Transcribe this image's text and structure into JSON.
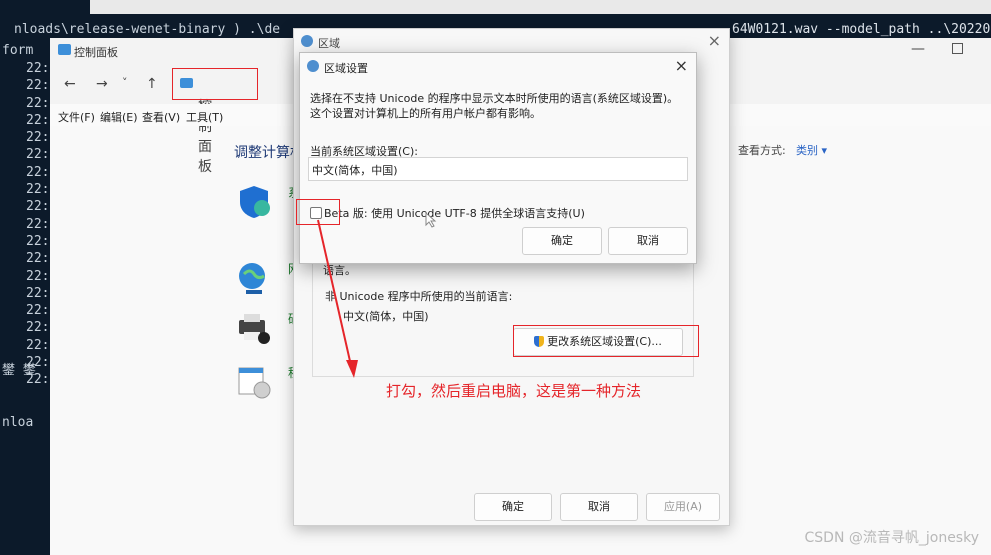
{
  "terminal": {
    "line_left": "nloads\\release-wenet-binary ) .\\de",
    "line_right": "64W0121.wav --model_path ..\\20220",
    "prompt_fragment": "form",
    "rows": [
      "22:",
      "22:",
      "22:",
      "22:",
      "22:",
      "22:",
      "22:",
      "22:",
      "22:",
      "22:",
      "22:",
      "22:",
      "22:",
      "22:",
      "22:",
      "22:",
      "22:",
      "22:",
      "22:"
    ],
    "garbled": "鐢 鐢",
    "tail": "nloa"
  },
  "control_panel": {
    "title": "控制面板",
    "address": "控制面板",
    "nav": {
      "back": "←",
      "forward": "→",
      "dropdown": "˅",
      "up": "↑",
      "sep": "›"
    },
    "menu": [
      "文件(F)",
      "编辑(E)",
      "查看(V)",
      "工具(T)"
    ],
    "heading": "调整计算机",
    "view_label": "查看方式:",
    "view_value": "类别 ▾",
    "categories": [
      "系",
      "网",
      "硬",
      "程"
    ]
  },
  "region_dialog": {
    "title": "区域",
    "close": "×",
    "partial_text": "语言。",
    "non_unicode_label": "非 Unicode 程序中所使用的当前语言:",
    "current_language": "中文(简体，中国)",
    "change_button": "更改系统区域设置(C)...",
    "ok": "确定",
    "cancel": "取消",
    "apply": "应用(A)"
  },
  "region_settings": {
    "title": "区域设置",
    "close": "×",
    "description": "选择在不支持 Unicode 的程序中显示文本时所使用的语言(系统区域设置)。这个设置对计算机上的所有用户帐户都有影响。",
    "current_label": "当前系统区域设置(C):",
    "current_value": "中文(简体，中国)",
    "beta_label": "Beta 版: 使用 Unicode UTF-8 提供全球语言支持(U)",
    "ok": "确定",
    "cancel": "取消"
  },
  "annotation": "打勾，然后重启电脑，这是第一种方法",
  "watermark": "CSDN @流音寻帆_jonesky",
  "colors": {
    "annotation_red": "#e5252a",
    "terminal_bg": "#0c1a2a",
    "link_blue": "#2a64c5"
  }
}
